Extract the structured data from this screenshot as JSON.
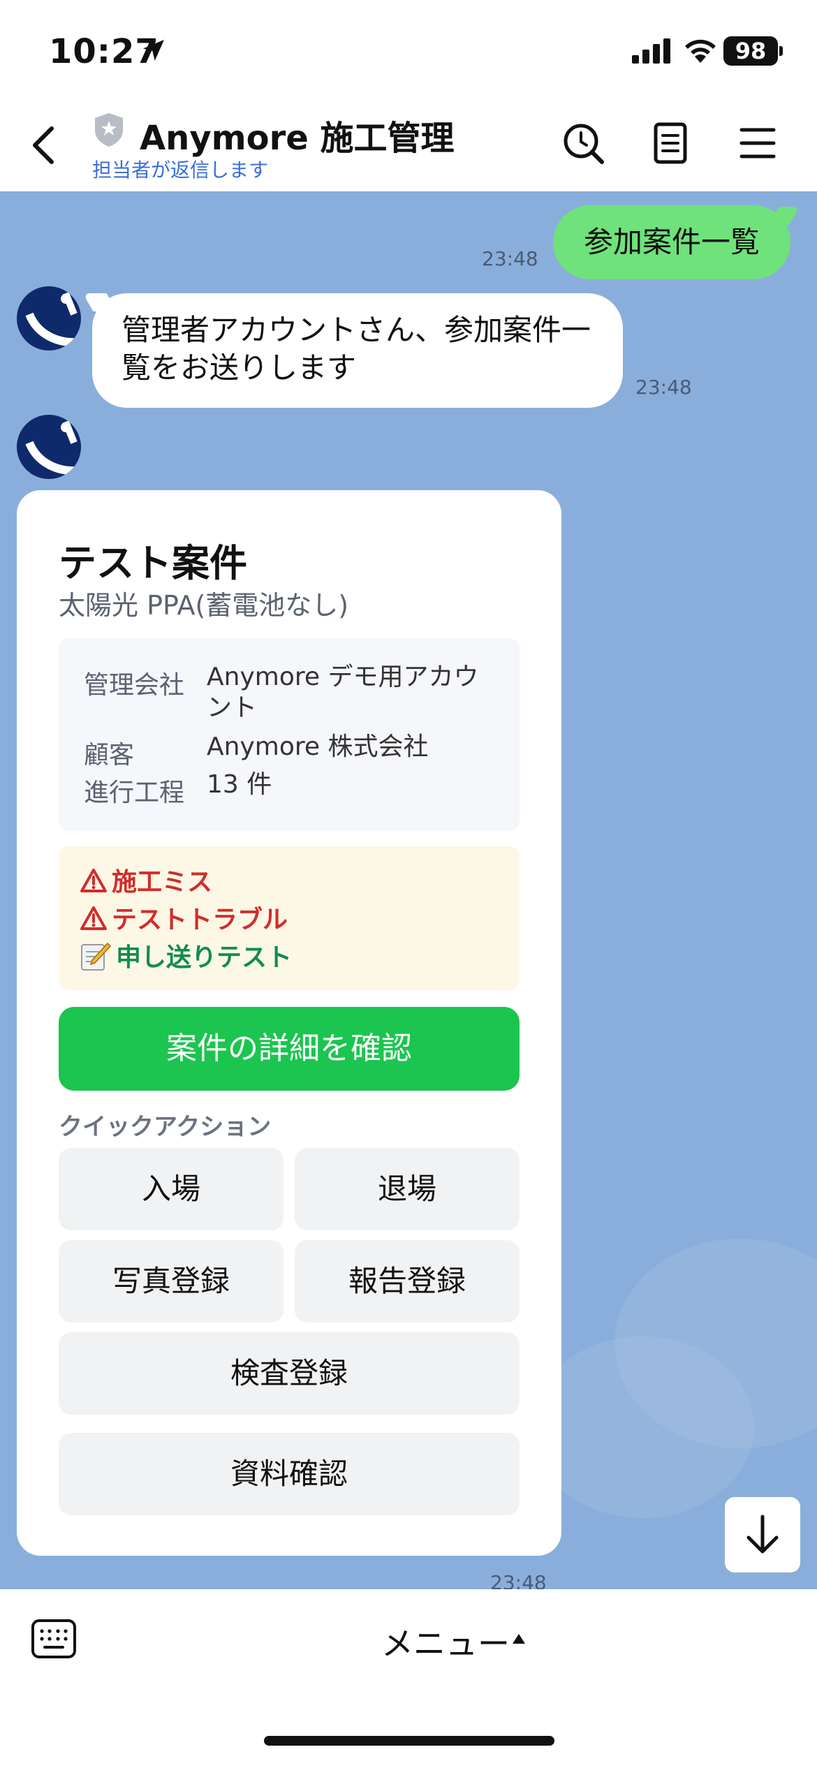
{
  "status_bar": {
    "time": "10:27",
    "battery": "98"
  },
  "header": {
    "title": "Anymore 施工管理",
    "subtitle": "担当者が返信します"
  },
  "messages": {
    "user_message": "参加案件一覧",
    "user_time": "23:48",
    "bot_message": "管理者アカウントさん、参加案件一覧をお送りします",
    "bot_time": "23:48",
    "card_time": "23:48"
  },
  "card": {
    "title": "テスト案件",
    "subtitle": "太陽光 PPA(蓄電池なし)",
    "info": [
      {
        "label": "管理会社",
        "value": "Anymore デモ用アカウント"
      },
      {
        "label": "顧客",
        "value": "Anymore 株式会社"
      },
      {
        "label": "進行工程",
        "value": "13 件"
      }
    ],
    "alerts": [
      {
        "text": "施工ミス",
        "icon": "warning-icon"
      },
      {
        "text": "テストトラブル",
        "icon": "warning-icon"
      },
      {
        "text": "申し送りテスト",
        "icon": "memo-icon"
      }
    ],
    "primary_button": "案件の詳細を確認",
    "quick_action_label": "クイックアクション",
    "quick_actions": [
      "入場",
      "退場",
      "写真登録",
      "報告登録",
      "検査登録",
      "資料確認"
    ]
  },
  "bottom_bar": {
    "menu_label": "メニュー"
  },
  "colors": {
    "chat_bg": "#8aaedb",
    "user_bubble": "#6fe27b",
    "primary_button": "#1bc54f",
    "alert_red": "#d22c2c",
    "alert_green": "#138a52",
    "subtitle_blue": "#3b6fd8"
  }
}
